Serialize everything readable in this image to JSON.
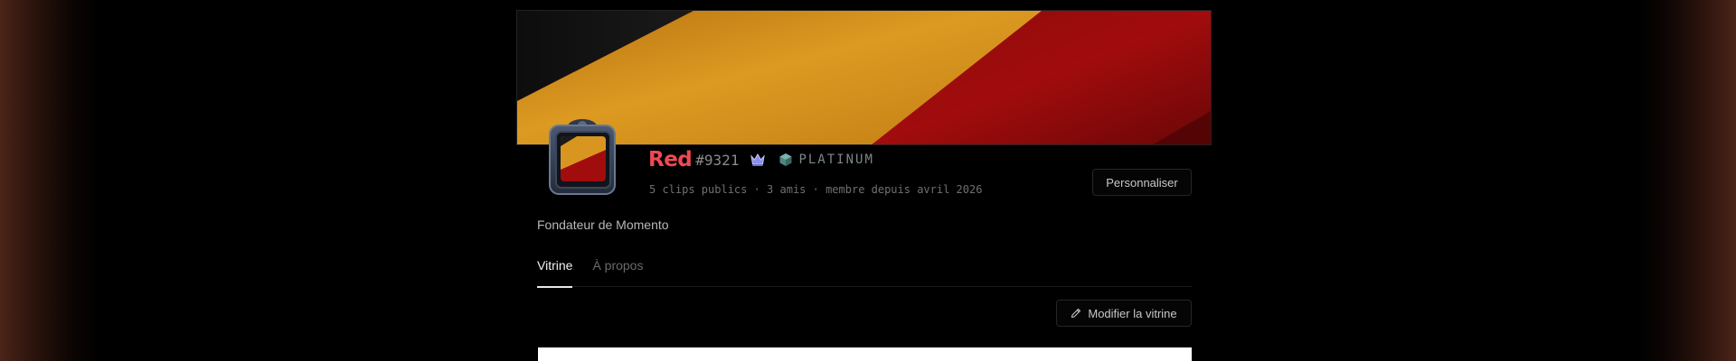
{
  "profile": {
    "username": "Red",
    "discriminator": "#9321",
    "rank_label": "PLATINUM",
    "stats": "5 clips publics · 3 amis · membre depuis avril 2026",
    "bio": "Fondateur de Momento"
  },
  "actions": {
    "customize_label": "Personnaliser",
    "edit_showcase_label": "Modifier la vitrine"
  },
  "tabs": [
    {
      "label": "Vitrine",
      "active": true
    },
    {
      "label": "À propos",
      "active": false
    }
  ],
  "icons": {
    "crown": "crown-icon",
    "rank": "platinum-gem-icon",
    "edit": "pencil-icon"
  },
  "colors": {
    "username": "#ee4a52",
    "banner_gold": "#d4921c",
    "banner_red": "#a10b0c",
    "rank": "#5f9c9a"
  }
}
